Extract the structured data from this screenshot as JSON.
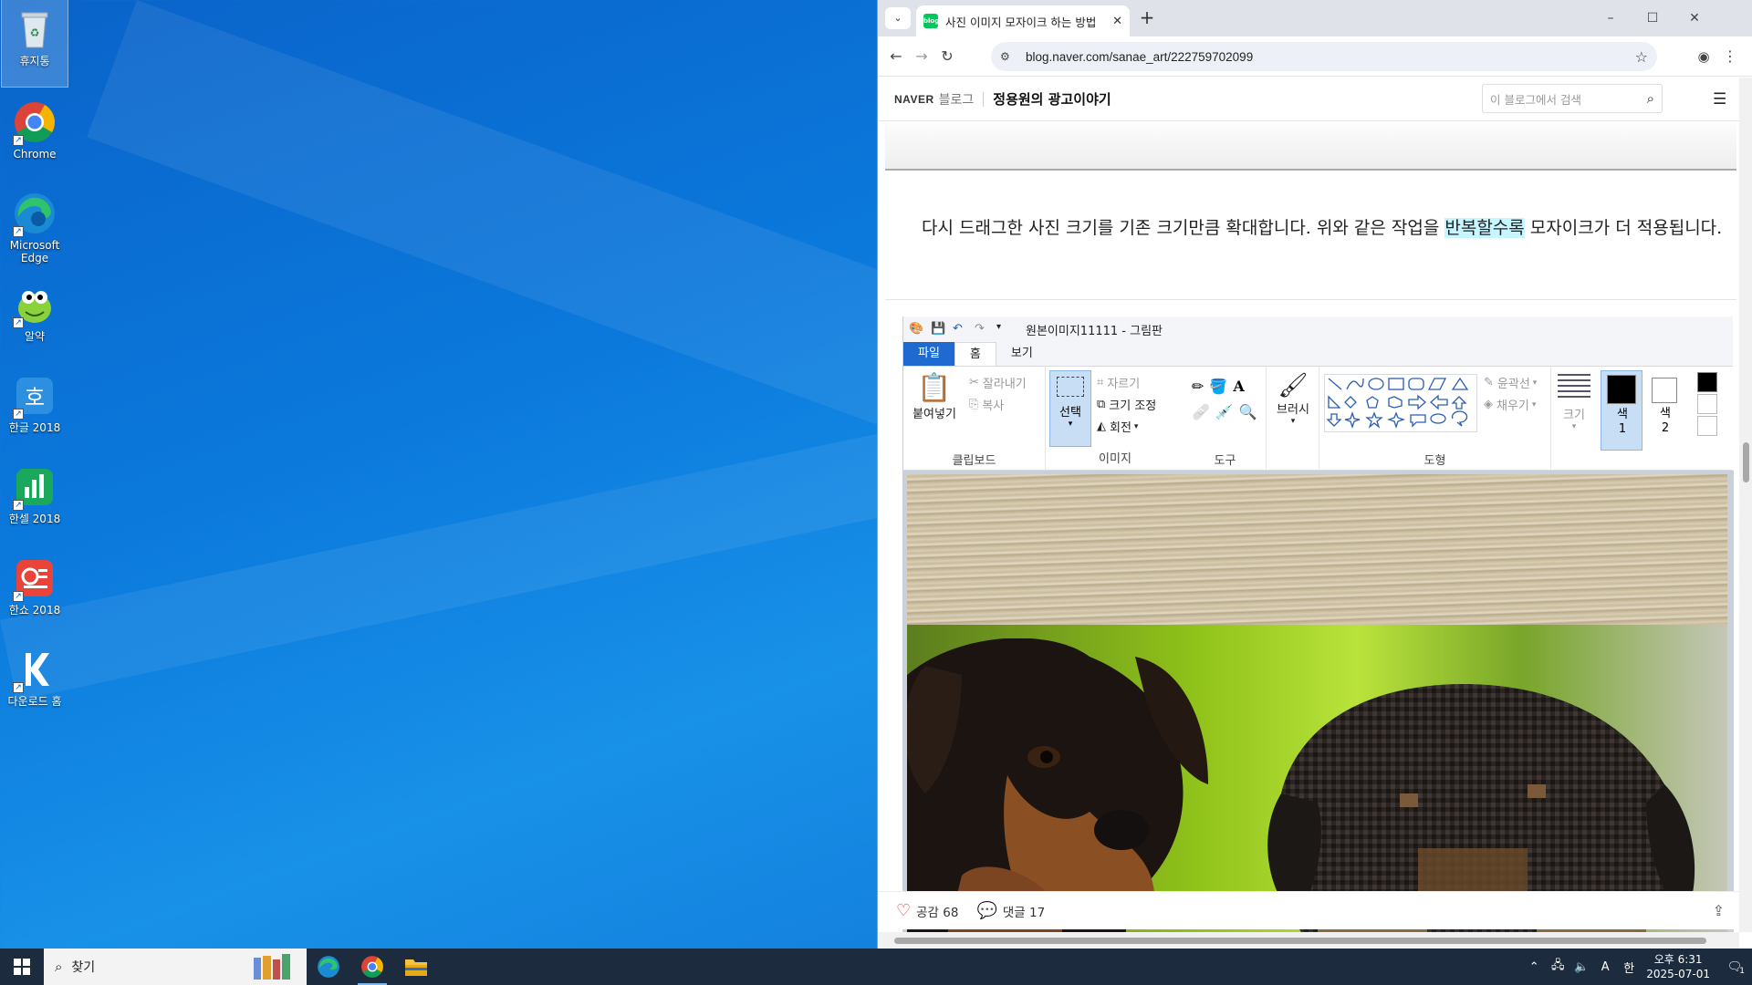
{
  "desktop": {
    "icons": [
      {
        "label": "휴지통",
        "icon": "recycle-bin-icon"
      },
      {
        "label": "Chrome",
        "icon": "chrome-icon"
      },
      {
        "label": "Microsoft Edge",
        "icon": "edge-icon"
      },
      {
        "label": "알약",
        "icon": "alyac-icon"
      },
      {
        "label": "한글 2018",
        "icon": "hangul-icon"
      },
      {
        "label": "한셀 2018",
        "icon": "hancell-icon"
      },
      {
        "label": "한쇼 2018",
        "icon": "hanshow-icon"
      },
      {
        "label": "다운로드 홈",
        "icon": "download-home-icon"
      }
    ]
  },
  "browser": {
    "tab_title": "사진 이미지 모자이크 하는 방법",
    "favicon_text": "blog",
    "url": "blog.naver.com/sanae_art/222759702099",
    "window_controls": [
      "–",
      "☐",
      "✕"
    ]
  },
  "blog": {
    "brand": "NAVER",
    "brand_sub": "블로그",
    "blog_name": "정용원의 광고이야기",
    "search_placeholder": "이 블로그에서 검색",
    "paragraph_before": "다시 드래그한 사진 크기를 기존 크기만큼 확대합니다. 위와 같은 작업을 ",
    "paragraph_highlight": "반복할수록",
    "paragraph_after": " 모자이크가 더 적용됩니다.",
    "like_label": "공감 68",
    "comment_label": "댓글 17"
  },
  "paint": {
    "title": "원본이미지11111 - 그림판",
    "tabs": [
      "파일",
      "홈",
      "보기"
    ],
    "clipboard": {
      "paste": "붙여넣기",
      "cut": "잘라내기",
      "copy": "복사",
      "group": "클립보드"
    },
    "image": {
      "select": "선택",
      "crop": "자르기",
      "resize": "크기 조정",
      "rotate": "회전",
      "group": "이미지"
    },
    "tools": {
      "group": "도구"
    },
    "brush": "브러시",
    "shapes": {
      "outline": "윤곽선",
      "fill": "채우기",
      "group": "도형"
    },
    "size": "크기",
    "color1": "색\n1",
    "color2": "색\n2",
    "color1_value": "#000000",
    "color2_value": "#ffffff"
  },
  "taskbar": {
    "search_placeholder": "찾기",
    "time": "오후 6:31",
    "date": "2025-07-01",
    "ime": "A",
    "notification_count": "1"
  },
  "colors": {
    "wallpaper": "#0b79dc",
    "taskbar": "#1c2b3d",
    "naver_green": "#03c75a",
    "paint_file_tab": "#1e6ad0",
    "highlight": "#c6f6ff"
  }
}
